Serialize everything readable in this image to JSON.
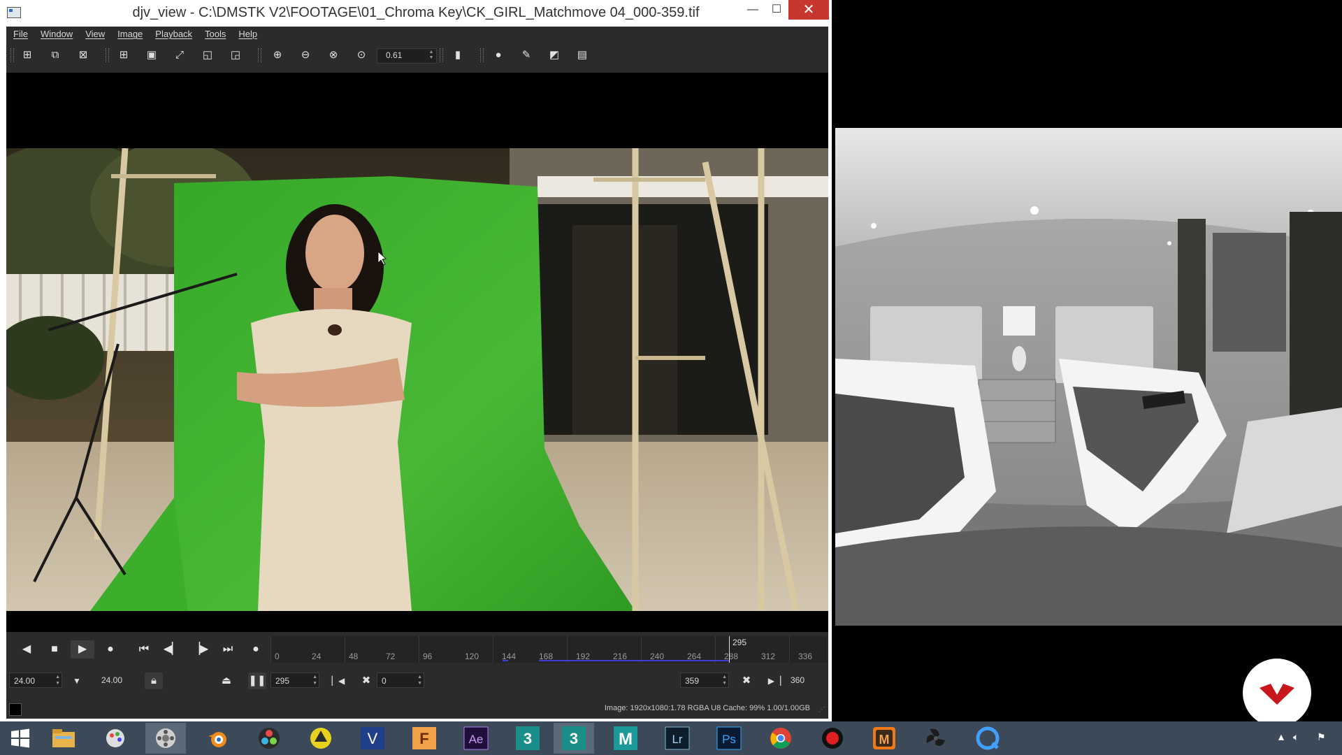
{
  "window": {
    "title": "djv_view - C:\\DMSTK V2\\FOOTAGE\\01_Chroma Key\\CK_GIRL_Matchmove 04_000-359.tif",
    "controls": {
      "minimize": "—",
      "maximize": "☐",
      "close": "✕"
    }
  },
  "menu": [
    "File",
    "Window",
    "View",
    "Image",
    "Playback",
    "Tools",
    "Help"
  ],
  "toolbar": {
    "zoom_value": "0.61",
    "icons": [
      "new-file-icon",
      "open-file-icon",
      "close-file-icon",
      "new-window-icon",
      "fit-window-icon",
      "fullscreen-icon",
      "controls-icon",
      "view-toggle-icon",
      "zoom-in-icon",
      "zoom-out-icon",
      "zoom-reset-icon",
      "zoom-fit-icon",
      "color-picker-icon",
      "magnify-icon",
      "eyedropper-icon",
      "histogram-icon",
      "info-icon"
    ]
  },
  "playback": {
    "timeline_ticks": [
      "0",
      "24",
      "48",
      "72",
      "96",
      "120",
      "144",
      "168",
      "192",
      "216",
      "240",
      "264",
      "288",
      "312",
      "336"
    ],
    "current_frame_label": "295",
    "speed": "24.00",
    "actual_speed": "24.00",
    "frame": "295",
    "in_point": "0",
    "out_point": "359",
    "end_frame": "360"
  },
  "status": {
    "info": "Image: 1920x1080:1.78 RGBA U8  Cache: 99% 1.00/1.00GB"
  },
  "taskbar": {
    "apps": [
      {
        "name": "start-icon",
        "label": ""
      },
      {
        "name": "file-explorer-icon",
        "label": ""
      },
      {
        "name": "paint-tool-icon",
        "label": ""
      },
      {
        "name": "djv-view-icon",
        "label": ""
      },
      {
        "name": "blender-icon",
        "label": ""
      },
      {
        "name": "davinci-resolve-icon",
        "label": ""
      },
      {
        "name": "natron-icon",
        "label": ""
      },
      {
        "name": "vray-icon",
        "label": "V"
      },
      {
        "name": "fusion-icon",
        "label": "F"
      },
      {
        "name": "after-effects-icon",
        "label": "Ae"
      },
      {
        "name": "3dsmax-icon",
        "label": "3"
      },
      {
        "name": "3dsmax-2-icon",
        "label": "3"
      },
      {
        "name": "maya-icon",
        "label": "M"
      },
      {
        "name": "lightroom-icon",
        "label": "Lr"
      },
      {
        "name": "photoshop-icon",
        "label": "Ps"
      },
      {
        "name": "chrome-icon",
        "label": ""
      },
      {
        "name": "record-icon",
        "label": ""
      },
      {
        "name": "mocha-icon",
        "label": "M"
      },
      {
        "name": "fan-app-icon",
        "label": ""
      },
      {
        "name": "quicktime-icon",
        "label": ""
      }
    ]
  },
  "colors": {
    "chroma_green": "#3fae2a",
    "timeline_cache": "#3f3fd8",
    "close_button": "#c7372f",
    "taskbar": "#3c4958"
  }
}
